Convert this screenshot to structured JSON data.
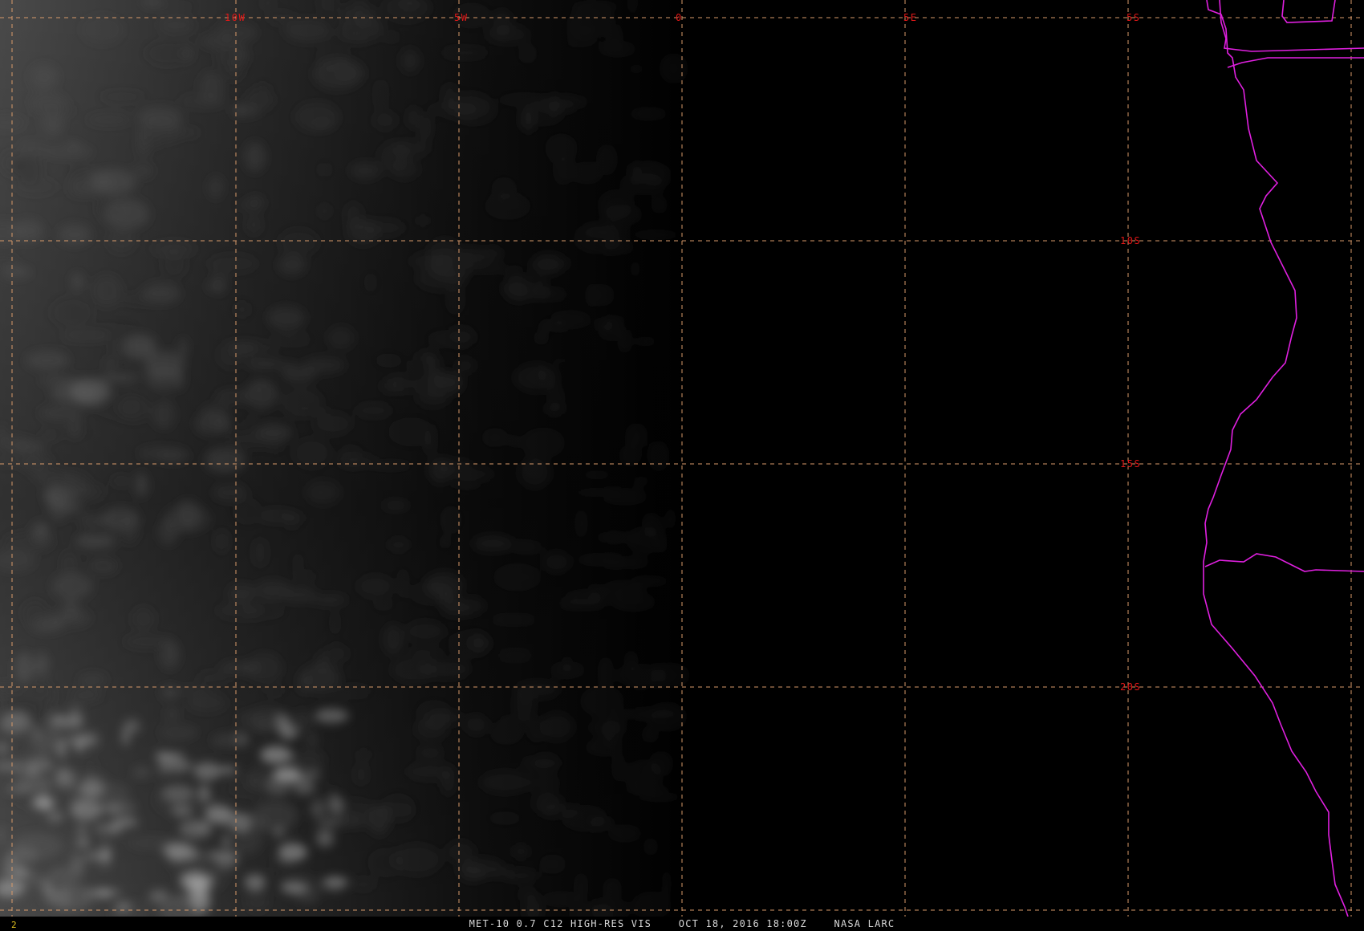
{
  "map": {
    "product": "MET-10 0.7 C12 HIGH-RES VIS",
    "frame_number": "2",
    "longitude_labels": [
      "10W",
      "5W",
      "0",
      "5E",
      "5S"
    ],
    "latitude_labels": [
      "10S",
      "15S",
      "20S"
    ],
    "colors": {
      "background": "#000000",
      "grid_line": "#d89a6a",
      "grid_label": "#e01818",
      "coastline": "#e020e0",
      "footer_text": "#d8d8d8",
      "frame_number": "#e0c020"
    },
    "footer_title": "MET-10 0.7 C12 HIGH-RES VIS    OCT 18, 2016 18:00Z    NASA LARC"
  }
}
